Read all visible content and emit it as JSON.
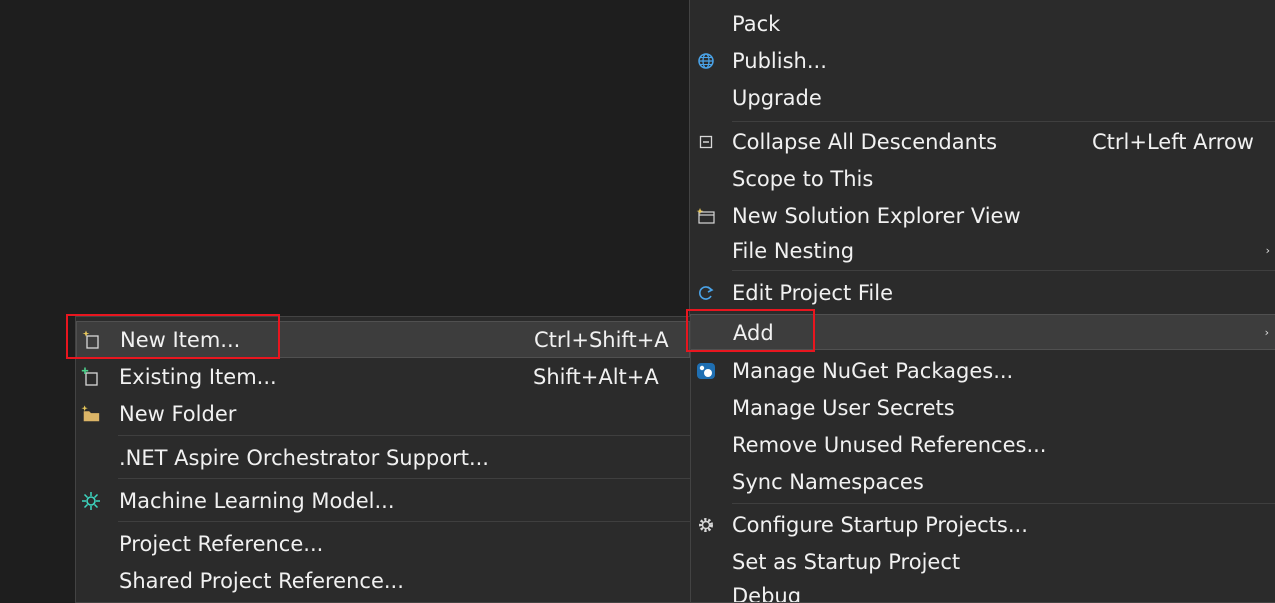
{
  "main_menu": {
    "items": [
      {
        "label": "Pack"
      },
      {
        "label": "Publish..."
      },
      {
        "label": "Upgrade"
      },
      {
        "label": "Collapse All Descendants",
        "shortcut": "Ctrl+Left Arrow"
      },
      {
        "label": "Scope to This"
      },
      {
        "label": "New Solution Explorer View"
      },
      {
        "label": "File Nesting"
      },
      {
        "label": "Edit Project File"
      },
      {
        "label": "Add"
      },
      {
        "label": "Manage NuGet Packages..."
      },
      {
        "label": "Manage User Secrets"
      },
      {
        "label": "Remove Unused References..."
      },
      {
        "label": "Sync Namespaces"
      },
      {
        "label": "Configure Startup Projects..."
      },
      {
        "label": "Set as Startup Project"
      },
      {
        "label": "Debug"
      }
    ],
    "submenu_arrow": "›"
  },
  "add_submenu": {
    "items": [
      {
        "label": "New Item...",
        "shortcut": "Ctrl+Shift+A"
      },
      {
        "label": "Existing Item...",
        "shortcut": "Shift+Alt+A"
      },
      {
        "label": "New Folder"
      },
      {
        "label": ".NET Aspire Orchestrator Support..."
      },
      {
        "label": "Machine Learning Model..."
      },
      {
        "label": "Project Reference..."
      },
      {
        "label": "Shared Project Reference..."
      }
    ]
  },
  "colors": {
    "background": "#1e1e1e",
    "menu_bg": "#2b2b2b",
    "hover_bg": "#3d3d3d",
    "highlight_border": "#e8161f",
    "icon_blue": "#4aa3e8"
  }
}
